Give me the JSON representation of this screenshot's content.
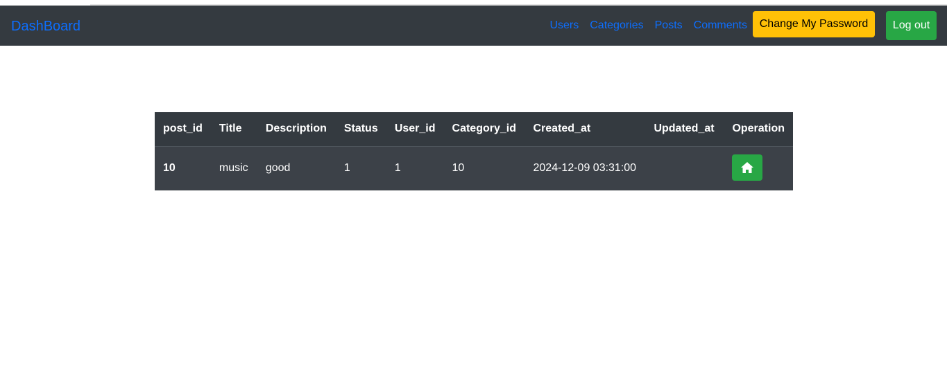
{
  "navbar": {
    "brand": "DashBoard",
    "links": [
      "Users",
      "Categories",
      "Posts",
      "Comments"
    ],
    "change_password_label": "Change My Password",
    "logout_label": "Log out"
  },
  "table": {
    "headers": [
      "post_id",
      "Title",
      "Description",
      "Status",
      "User_id",
      "Category_id",
      "Created_at",
      "Updated_at",
      "Operation"
    ],
    "rows": [
      {
        "post_id": "10",
        "title": "music",
        "description": "good",
        "status": "1",
        "user_id": "1",
        "category_id": "10",
        "created_at": "2024-12-09 03:31:00",
        "updated_at": "",
        "operation_icon": "home-icon"
      }
    ]
  },
  "colors": {
    "navbar_bg": "#343a40",
    "link": "#0d6efd",
    "warning": "#ffc107",
    "success": "#28a745",
    "table_bg": "#3c4148"
  }
}
